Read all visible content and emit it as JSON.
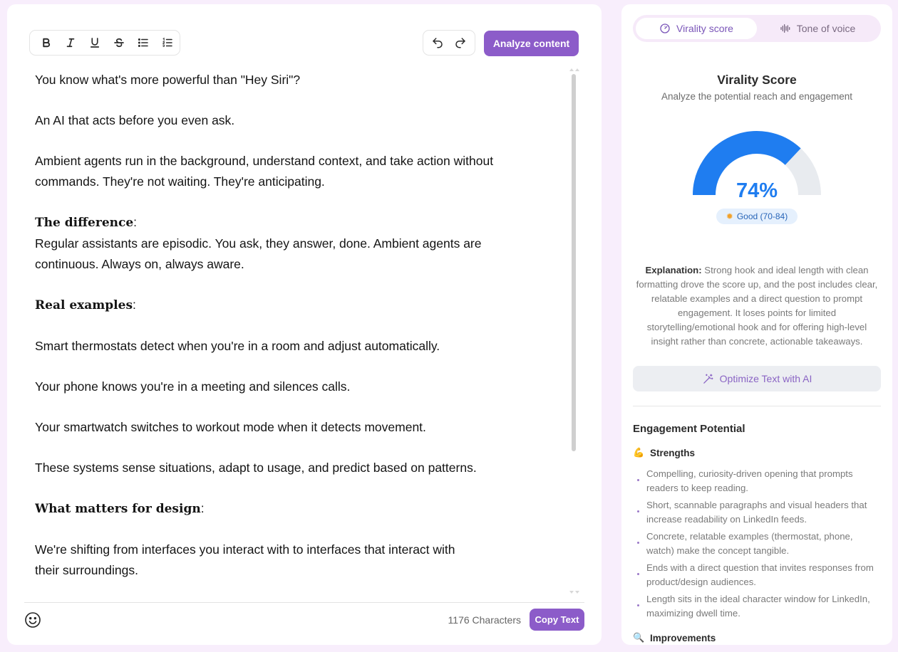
{
  "editor": {
    "toolbar": {
      "bold_icon": "bold-icon",
      "italic_icon": "italic-icon",
      "underline_icon": "underline-icon",
      "strikethrough_icon": "strikethrough-icon",
      "bullet_list_icon": "bullet-list-icon",
      "numbered_list_icon": "numbered-list-icon",
      "undo_icon": "undo-icon",
      "redo_icon": "redo-icon"
    },
    "analyze_button": "Analyze content",
    "paragraphs": {
      "p1": "You know what's more powerful than \"Hey Siri\"?",
      "p2": "An AI that acts before you even ask.",
      "p3_line1": "Ambient agents run in the background, understand context, and take action without",
      "p3_line2": "commands. They're not waiting. They're anticipating.",
      "h1": "The difference",
      "p4_line1": "Regular assistants are episodic. You ask, they answer, done. Ambient agents are",
      "p4_line2": "continuous. Always on, always aware.",
      "h2": "Real examples",
      "p5": "Smart thermostats detect when you're in a room and adjust automatically.",
      "p6": "Your phone knows you're in a meeting and silences calls.",
      "p7": "Your smartwatch switches to workout mode when it detects movement.",
      "p8": "These systems sense situations, adapt to usage, and predict based on patterns.",
      "h3": "What matters for design",
      "p9_line1": "We're shifting from interfaces you interact with to interfaces that interact with",
      "p9_line2": "their surroundings."
    },
    "heading_colon": ":",
    "emoji_icon": "smiley-icon",
    "char_count": "1176 Characters",
    "copy_button": "Copy Text"
  },
  "analysis": {
    "tabs": [
      {
        "label": "Virality score",
        "icon": "gauge-icon",
        "active": true
      },
      {
        "label": "Tone of voice",
        "icon": "waveform-icon",
        "active": false
      }
    ],
    "title": "Virality Score",
    "subtitle": "Analyze the potential reach and engagement",
    "score_value": "74%",
    "score_fraction": 0.74,
    "gauge_colors": {
      "fill": "#1f7df0",
      "track": "#e8ebef"
    },
    "rating_icon": "sun-icon",
    "rating": "Good (70-84)",
    "explanation_label": "Explanation:",
    "explanation_text": " Strong hook and ideal length with clean formatting drove the score up, and the post includes clear, relatable examples and a direct question to prompt engagement. It loses points for limited storytelling/emotional hook and for offering high-level insight rather than concrete, actionable takeaways.",
    "optimize_button": "Optimize Text with AI",
    "optimize_icon": "magic-wand-icon",
    "engagement_heading": "Engagement Potential",
    "strengths": {
      "icon": "flexed-biceps-icon",
      "heading": "Strengths",
      "items": [
        "Compelling, curiosity-driven opening that prompts readers to keep reading.",
        "Short, scannable paragraphs and visual headers that increase readability on LinkedIn feeds.",
        "Concrete, relatable examples (thermostat, phone, watch) make the concept tangible.",
        "Ends with a direct question that invites responses from product/design audiences.",
        "Length sits in the ideal character window for LinkedIn, maximizing dwell time."
      ]
    },
    "improvements": {
      "icon": "magnifier-icon",
      "heading": "Improvements"
    },
    "accent_color": "#8c5cc9"
  }
}
